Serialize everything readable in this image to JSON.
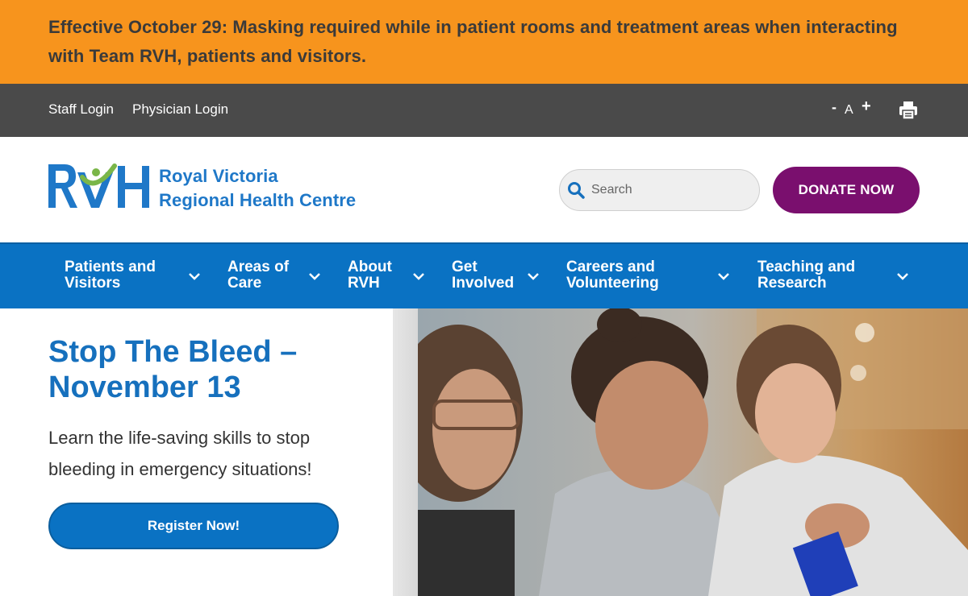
{
  "alert": {
    "text": "Effective October 29: Masking required while in patient rooms and treatment areas when interacting with Team RVH, patients and visitors."
  },
  "utility": {
    "staff_login": "Staff Login",
    "physician_login": "Physician Login",
    "font_decrease": "-",
    "font_label": "A",
    "font_increase": "+",
    "print_icon": "print-icon"
  },
  "header": {
    "logo_letters": "RVH",
    "logo_line1": "Royal Victoria",
    "logo_line2": "Regional Health Centre",
    "search_placeholder": "Search",
    "donate_label": "DONATE NOW"
  },
  "nav": {
    "items": [
      {
        "line1": "Patients and",
        "line2": "Visitors"
      },
      {
        "line1": "Areas of",
        "line2": "Care"
      },
      {
        "line1": "About",
        "line2": "RVH"
      },
      {
        "line1": "Get",
        "line2": "Involved"
      },
      {
        "line1": "Careers and",
        "line2": "Volunteering"
      },
      {
        "line1": "Teaching and",
        "line2": "Research"
      }
    ]
  },
  "hero": {
    "title": "Stop The Bleed – November 13",
    "text": "Learn the life-saving skills to stop bleeding in emergency situations!",
    "button_label": "Register Now!"
  },
  "colors": {
    "alert_bg": "#f7941d",
    "utility_bg": "#4a4a4a",
    "nav_bg": "#0a72c3",
    "donate_bg": "#7a0f6e",
    "brand_blue": "#1f78c8",
    "brand_green": "#7ab648"
  }
}
